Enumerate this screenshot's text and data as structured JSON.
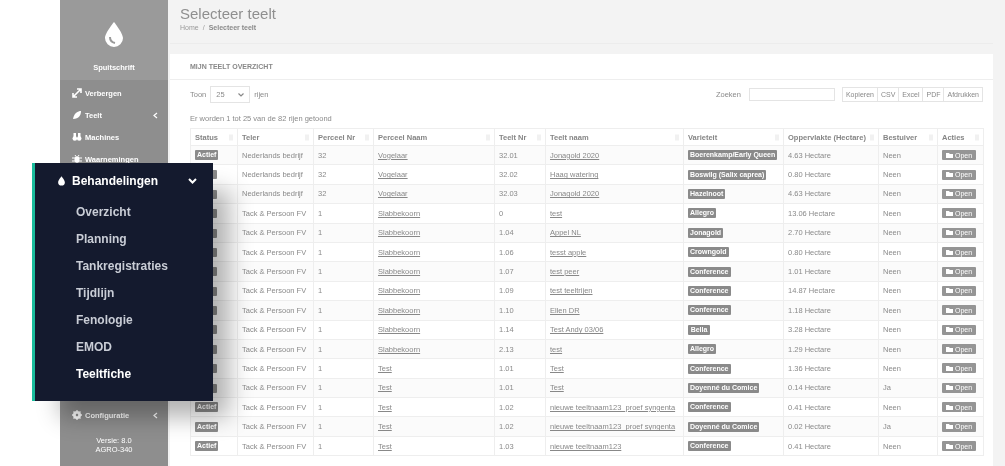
{
  "sidebar": {
    "brand": "Spuitschrift",
    "items": [
      {
        "label": "Verbergen",
        "has_submenu": false
      },
      {
        "label": "Teelt",
        "has_submenu": true
      },
      {
        "label": "Machines",
        "has_submenu": false
      },
      {
        "label": "Waarnemingen",
        "has_submenu": false
      }
    ],
    "footer_items": [
      {
        "label": "Configuratie",
        "has_submenu": true
      }
    ],
    "version": "Versie: 8.0",
    "build": "AGRO-340"
  },
  "page": {
    "title": "Selecteer teelt",
    "breadcrumb": [
      "Home",
      "Selecteer teelt"
    ],
    "breadcrumb_separator": "/"
  },
  "card": {
    "title": "MIJN TEELT OVERZICHT",
    "length_before": "Toon",
    "length_value": "25",
    "length_after": "rijen",
    "search_label": "Zoeken",
    "export_buttons": [
      "Kopieren",
      "CSV",
      "Excel",
      "PDF",
      "Afdrukken"
    ],
    "info": "Er worden 1 tot 25 van de 82 rijen getoond"
  },
  "table": {
    "columns": [
      "Status",
      "Teler",
      "Perceel Nr",
      "Perceel Naam",
      "Teelt Nr",
      "Teelt naam",
      "Varieteit",
      "Oppervlakte (Hectare)",
      "Bestuiver",
      "Acties"
    ],
    "rows": [
      {
        "status": "Actief",
        "teler": "Nederlands bedrijf",
        "perceel_nr": "32",
        "perceel_naam": "Vogelaar",
        "teelt_nr": "32.01",
        "teelt_naam": "Jonagold 2020",
        "variety": "Boerenkamp/Early Queen",
        "area": "4.63 Hectare",
        "bestuiver": "Neen",
        "action": "Open"
      },
      {
        "teler": "Nederlands bedrijf",
        "perceel_nr": "32",
        "perceel_naam": "Vogelaar",
        "teelt_nr": "32.02",
        "teelt_naam": "Haag watering",
        "variety": "Boswilg (Salix caprea)",
        "area": "0.80 Hectare",
        "bestuiver": "Neen",
        "action": "Open"
      },
      {
        "teler": "Nederlands bedrijf",
        "perceel_nr": "32",
        "perceel_naam": "Vogelaar",
        "teelt_nr": "32.03",
        "teelt_naam": "Jonagold 2020",
        "variety": "Hazelnoot",
        "area": "4.63 Hectare",
        "bestuiver": "Neen",
        "action": "Open"
      },
      {
        "teler": "Tack & Persoon FV",
        "perceel_nr": "1",
        "perceel_naam": "Slabbekoorn",
        "teelt_nr": "0",
        "teelt_naam": "test",
        "variety": "Allegro",
        "area": "13.06 Hectare",
        "bestuiver": "Neen",
        "action": "Open"
      },
      {
        "teler": "Tack & Persoon FV",
        "perceel_nr": "1",
        "perceel_naam": "Slabbekoorn",
        "teelt_nr": "1.04",
        "teelt_naam": "Appel NL",
        "variety": "Jonagold",
        "area": "2.70 Hectare",
        "bestuiver": "Neen",
        "action": "Open"
      },
      {
        "teler": "Tack & Persoon FV",
        "perceel_nr": "1",
        "perceel_naam": "Slabbekoorn",
        "teelt_nr": "1.06",
        "teelt_naam": "tesst apple",
        "variety": "Crowngold",
        "area": "0.80 Hectare",
        "bestuiver": "Neen",
        "action": "Open"
      },
      {
        "teler": "Tack & Persoon FV",
        "perceel_nr": "1",
        "perceel_naam": "Slabbekoorn",
        "teelt_nr": "1.07",
        "teelt_naam": "test peer",
        "variety": "Conference",
        "area": "1.01 Hectare",
        "bestuiver": "Neen",
        "action": "Open"
      },
      {
        "teler": "Tack & Persoon FV",
        "perceel_nr": "1",
        "perceel_naam": "Slabbekoorn",
        "teelt_nr": "1.09",
        "teelt_naam": "test teeltrijen",
        "variety": "Conference",
        "area": "14.87 Hectare",
        "bestuiver": "Neen",
        "action": "Open"
      },
      {
        "teler": "Tack & Persoon FV",
        "perceel_nr": "1",
        "perceel_naam": "Slabbekoorn",
        "teelt_nr": "1.10",
        "teelt_naam": "Ellen DR",
        "variety": "Conference",
        "area": "1.18 Hectare",
        "bestuiver": "Neen",
        "action": "Open"
      },
      {
        "teler": "Tack & Persoon FV",
        "perceel_nr": "1",
        "perceel_naam": "Slabbekoorn",
        "teelt_nr": "1.14",
        "teelt_naam": "Test Andy 03/06",
        "variety": "Bella",
        "area": "3.28 Hectare",
        "bestuiver": "Neen",
        "action": "Open"
      },
      {
        "teler": "Tack & Persoon FV",
        "perceel_nr": "1",
        "perceel_naam": "Slabbekoorn",
        "teelt_nr": "2.13",
        "teelt_naam": "test",
        "variety": "Allegro",
        "area": "1.29 Hectare",
        "bestuiver": "Neen",
        "action": "Open"
      },
      {
        "teler": "Tack & Persoon FV",
        "perceel_nr": "1",
        "perceel_naam": "Test",
        "teelt_nr": "1.01",
        "teelt_naam": "Test",
        "variety": "Conference",
        "area": "1.36 Hectare",
        "bestuiver": "Neen",
        "action": "Open"
      },
      {
        "teler": "Tack & Persoon FV",
        "perceel_nr": "1",
        "perceel_naam": "Test",
        "teelt_nr": "1.01",
        "teelt_naam": "Test",
        "variety": "Doyenné du Comice",
        "area": "0.14 Hectare",
        "bestuiver": "Ja",
        "action": "Open"
      },
      {
        "status": "Actief",
        "teler": "Tack & Persoon FV",
        "perceel_nr": "1",
        "perceel_naam": "Test",
        "teelt_nr": "1.02",
        "teelt_naam": "nieuwe teeltnaam123_proef syngenta",
        "variety": "Conference",
        "area": "0.41 Hectare",
        "bestuiver": "Neen",
        "action": "Open"
      },
      {
        "status": "Actief",
        "teler": "Tack & Persoon FV",
        "perceel_nr": "1",
        "perceel_naam": "Test",
        "teelt_nr": "1.02",
        "teelt_naam": "nieuwe teeltnaam123_proef syngenta",
        "variety": "Doyenné du Comice",
        "area": "0.02 Hectare",
        "bestuiver": "Ja",
        "action": "Open"
      },
      {
        "status": "Actief",
        "teler": "Tack & Persoon FV",
        "perceel_nr": "1",
        "perceel_naam": "Test",
        "teelt_nr": "1.03",
        "teelt_naam": "nieuwe teeltnaam123",
        "variety": "Conference",
        "area": "0.41 Hectare",
        "bestuiver": "Neen",
        "action": "Open"
      }
    ]
  },
  "popup": {
    "title": "Behandelingen",
    "expanded": true,
    "items": [
      {
        "label": "Overzicht",
        "selected": false
      },
      {
        "label": "Planning",
        "selected": false
      },
      {
        "label": "Tankregistraties",
        "selected": false
      },
      {
        "label": "Tijdlijn",
        "selected": false
      },
      {
        "label": "Fenologie",
        "selected": false
      },
      {
        "label": "EMOD",
        "selected": false
      },
      {
        "label": "Teeltfiche",
        "selected": true
      }
    ]
  }
}
